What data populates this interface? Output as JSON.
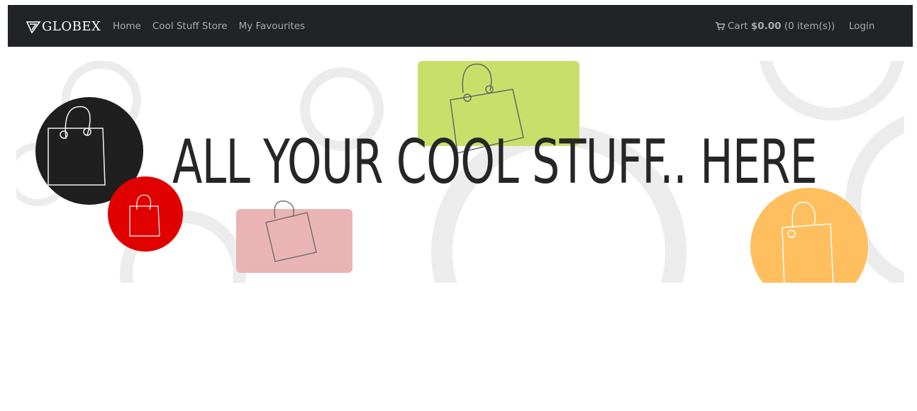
{
  "nav": {
    "brand": "GLOBEX",
    "brand_icon": "globex-logo-icon",
    "links": [
      "Home",
      "Cool Stuff Store",
      "My Favourites"
    ],
    "cart": {
      "icon": "shopping-cart-icon",
      "label": "Cart",
      "amount": "$0.00",
      "items": "(0 item(s))"
    },
    "login": "Login"
  },
  "banner": {
    "headline": "ALL YOUR COOL STUFF.. HERE",
    "colors": {
      "black": "#1f1f1f",
      "red": "#e10000",
      "green": "#c8e06a",
      "pink": "#e9b4b3",
      "orange": "#ffbf5e",
      "rings": "#ececec"
    }
  }
}
